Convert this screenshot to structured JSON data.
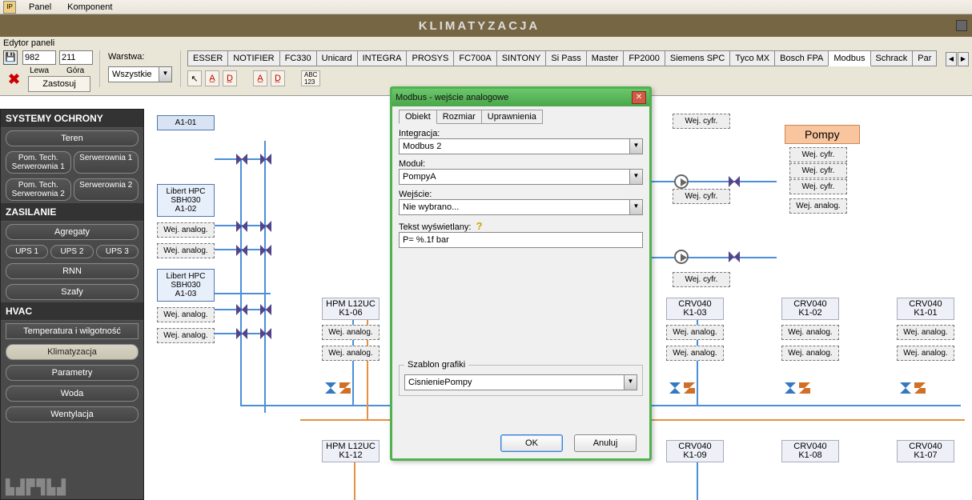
{
  "menubar": {
    "items": [
      "Panel",
      "Komponent"
    ]
  },
  "titlebar": {
    "title": "KLIMATYZACJA"
  },
  "editor": {
    "title": "Edytor paneli",
    "coord_x": "982",
    "coord_y": "211",
    "left_label": "Lewa",
    "top_label": "Góra",
    "apply": "Zastosuj",
    "layer_label": "Warstwa:",
    "layer_value": "Wszystkie",
    "tabs": [
      "ESSER",
      "NOTIFIER",
      "FC330",
      "Unicard",
      "INTEGRA",
      "PROSYS",
      "FC700A",
      "SINTONY",
      "Si Pass",
      "Master",
      "FP2000",
      "Siemens SPC",
      "Tyco MX",
      "Bosch FPA",
      "Modbus",
      "Schrack",
      "Par"
    ],
    "tab_active": 14
  },
  "sidebar": {
    "sec1": "SYSTEMY OCHRONY",
    "sec1_btns": [
      "Teren"
    ],
    "sec1_row1": [
      "Pom. Tech. Serwerownia 1",
      "Serwerownia 1"
    ],
    "sec1_row2": [
      "Pom. Tech. Serwerownia 2",
      "Serwerownia 2"
    ],
    "sec2": "ZASILANIE",
    "sec2_btns": [
      "Agregaty"
    ],
    "sec2_row": [
      "UPS 1",
      "UPS 2",
      "UPS 3"
    ],
    "sec2_btns2": [
      "RNN",
      "Szafy"
    ],
    "sec3": "HVAC",
    "sec3_btns": [
      "Temperatura i wilgotność",
      "Klimatyzacja",
      "Parametry",
      "Woda",
      "Wentylacja"
    ],
    "active_sec3": 1
  },
  "canvas": {
    "a101": "A1-01",
    "hpc2": "Libert HPC\nSBH030\nA1-02",
    "hpc3": "Libert HPC\nSBH030\nA1-03",
    "wej_analog": "Wej. analog.",
    "wej_cyfr": "Wej. cyfr.",
    "pompy": "Pompy",
    "hpm": "HPM L12UC",
    "crv": "CRV040",
    "k106": "K1-06",
    "k103": "K1-03",
    "k102": "K1-02",
    "k101": "K1-01",
    "k112": "K1-12",
    "k109": "K1-09",
    "k108": "K1-08",
    "k107": "K1-07"
  },
  "modal": {
    "title": "Modbus - wejście analogowe",
    "tabs": [
      "Obiekt",
      "Rozmiar",
      "Uprawnienia"
    ],
    "l_int": "Integracja:",
    "v_int": "Modbus 2",
    "l_mod": "Moduł:",
    "v_mod": "PompyA",
    "l_wej": "Wejście:",
    "v_wej": "Nie wybrano...",
    "l_txt": "Tekst wyświetlany:",
    "v_txt": "P= %.1f bar",
    "fs_legend": "Szablon grafiki",
    "v_sz": "CisnieniePompy",
    "ok": "OK",
    "cancel": "Anuluj"
  }
}
